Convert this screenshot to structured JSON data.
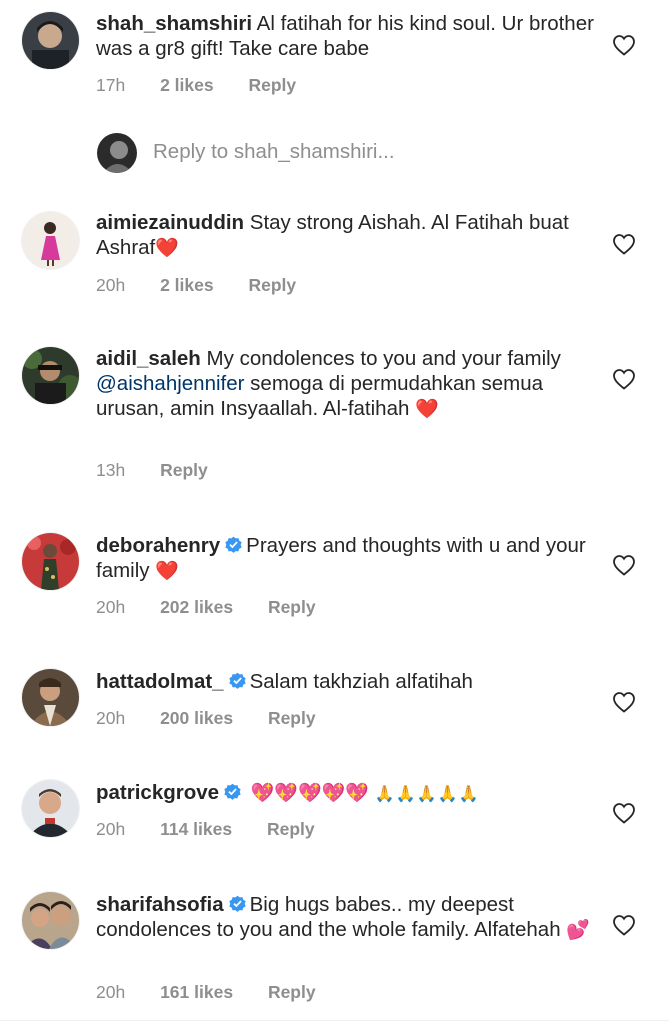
{
  "comments": [
    {
      "username": "shah_shamshiri",
      "text": "Al fatihah for his kind soul. Ur brother was a gr8 gift! Take care babe",
      "time": "17h",
      "likes": "2 likes",
      "reply": "Reply",
      "verified": false,
      "avatar_color": "#3a3f45"
    },
    {
      "username": "aimiezainuddin",
      "text": "Stay strong Aishah. Al Fatihah buat Ashraf",
      "emoji": "heart-emoji",
      "time": "20h",
      "likes": "2 likes",
      "reply": "Reply",
      "verified": false,
      "avatar_color": "#e9e2da"
    },
    {
      "username": "aidil_saleh",
      "text_before": "My condolences to you and your family",
      "mention": "@aishahjennifer",
      "text_after": "semoga di permudahkan semua urusan, amin Insyaallah. Al-fatihah",
      "emoji": "heart-emoji",
      "time": "13h",
      "reply": "Reply",
      "verified": false,
      "avatar_color": "#2e3b2c"
    },
    {
      "username": "deborahenry",
      "text": "Prayers and thoughts with u and your family",
      "emoji": "heart-emoji",
      "time": "20h",
      "likes": "202 likes",
      "reply": "Reply",
      "verified": true,
      "avatar_color": "#c73a3a"
    },
    {
      "username": "hattadolmat_",
      "text": "Salam takhziah alfatihah",
      "time": "20h",
      "likes": "200 likes",
      "reply": "Reply",
      "verified": true,
      "avatar_color": "#8a6b4e"
    },
    {
      "username": "patrickgrove",
      "emoji": "sparkling-heart-emoji x5, folded-hands-emoji x5",
      "time": "20h",
      "likes": "114 likes",
      "reply": "Reply",
      "verified": true,
      "avatar_color": "#cfd3d8"
    },
    {
      "username": "sharifahsofia",
      "text": "Big hugs babes.. my deepest condolences to you and the whole family. Alfatehah",
      "emoji": "two-hearts-emoji",
      "time": "20h",
      "likes": "161 likes",
      "reply": "Reply",
      "verified": true,
      "avatar_color": "#b9a48c"
    }
  ],
  "reply_box": {
    "placeholder": "Reply to shah_shamshiri..."
  },
  "colors": {
    "text": "#262626",
    "meta": "#8e8e8e",
    "mention": "#003569",
    "verified": "#3897f0",
    "heart_emoji": "#e02020"
  }
}
